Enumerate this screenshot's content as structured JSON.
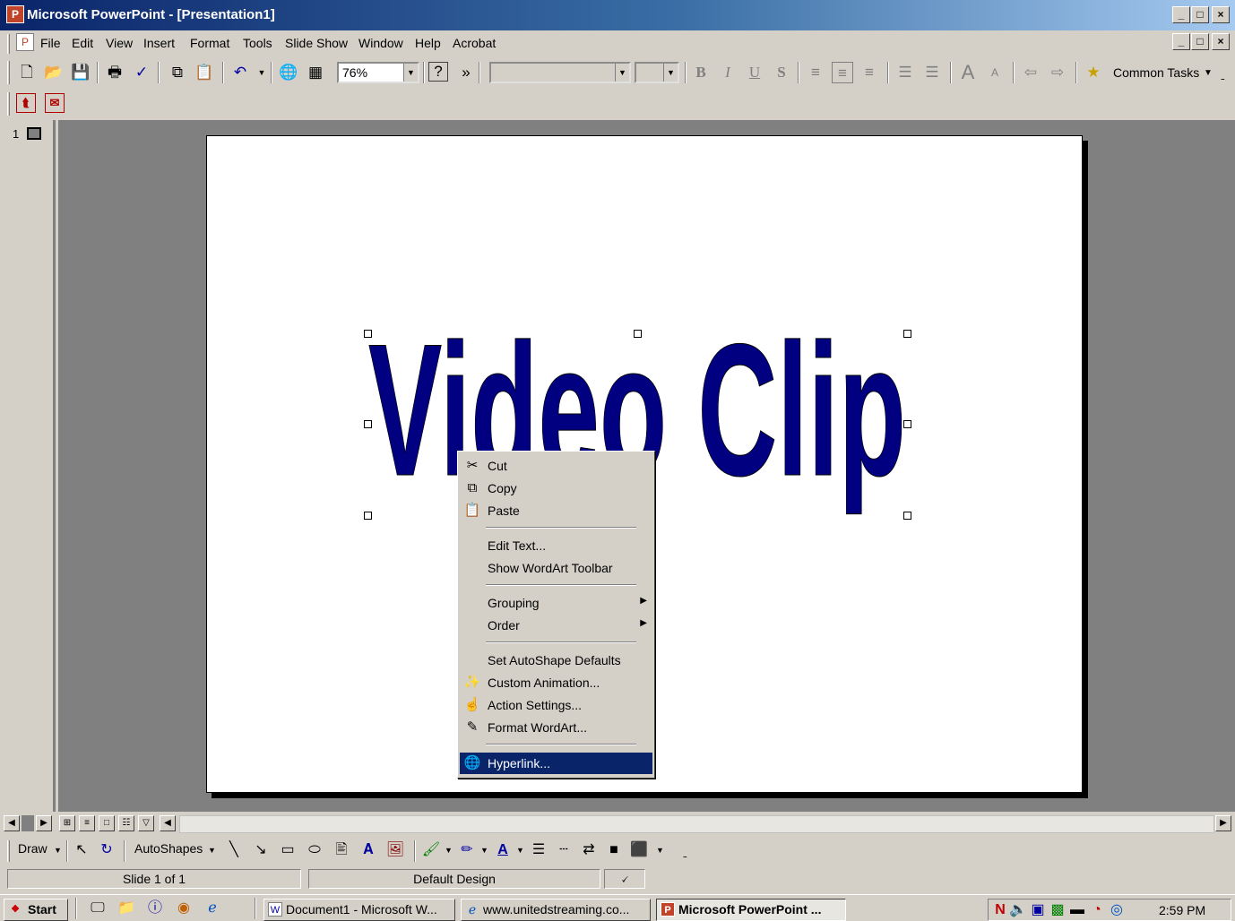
{
  "window": {
    "title": "Microsoft PowerPoint - [Presentation1]",
    "app_icon": "powerpoint-icon",
    "controls": [
      "_",
      "□",
      "×"
    ]
  },
  "menu": {
    "items": [
      "File",
      "Edit",
      "View",
      "Insert",
      "Format",
      "Tools",
      "Slide Show",
      "Window",
      "Help",
      "Acrobat"
    ]
  },
  "toolbar": {
    "zoom": "76%",
    "more": "»",
    "common_tasks": "Common Tasks",
    "icons": [
      "new-icon",
      "open-icon",
      "save-icon",
      "print-icon",
      "spelling-icon",
      "copy-icon",
      "paste-icon",
      "undo-icon",
      "hyperlink-icon",
      "tables-icon",
      "help-icon",
      "bold-icon",
      "italic-icon",
      "underline-icon",
      "shadow-icon",
      "align-left-icon",
      "center-icon",
      "align-right-icon",
      "numbering-icon",
      "bullets-icon",
      "increase-font-icon",
      "decrease-font-icon",
      "promote-icon",
      "demote-icon",
      "common-tasks-icon"
    ]
  },
  "acrobat_toolbar": {
    "icons": [
      "pdf-convert-icon",
      "pdf-email-icon"
    ]
  },
  "slides_pane": {
    "slide_number": "1"
  },
  "slide": {
    "wordart_text": "Video Clip",
    "wordart_color": "#000080"
  },
  "context_menu": {
    "items": [
      {
        "label": "Cut",
        "icon": "scissors-icon"
      },
      {
        "label": "Copy",
        "icon": "copy-icon"
      },
      {
        "label": "Paste",
        "icon": "paste-icon"
      },
      {
        "label": "Edit Text...",
        "icon": ""
      },
      {
        "label": "Show WordArt Toolbar",
        "icon": ""
      },
      {
        "label": "Grouping",
        "icon": "",
        "submenu": true
      },
      {
        "label": "Order",
        "icon": "",
        "submenu": true
      },
      {
        "label": "Set AutoShape Defaults",
        "icon": ""
      },
      {
        "label": "Custom Animation...",
        "icon": "custom-animation-icon"
      },
      {
        "label": "Action Settings...",
        "icon": "action-settings-icon"
      },
      {
        "label": "Format WordArt...",
        "icon": "format-wordart-icon"
      },
      {
        "label": "Hyperlink...",
        "icon": "hyperlink-icon",
        "highlighted": true
      }
    ]
  },
  "drawing_toolbar": {
    "draw": "Draw",
    "autoshapes": "AutoShapes"
  },
  "status": {
    "slide": "Slide 1 of 1",
    "design": "Default Design"
  },
  "taskbar": {
    "start": "Start",
    "tasks": [
      {
        "label": "Document1 - Microsoft W...",
        "icon": "word-icon"
      },
      {
        "label": "www.unitedstreaming.co...",
        "icon": "ie-icon"
      },
      {
        "label": "Microsoft PowerPoint ...",
        "icon": "powerpoint-icon",
        "active": true
      }
    ],
    "clock": "2:59 PM"
  }
}
